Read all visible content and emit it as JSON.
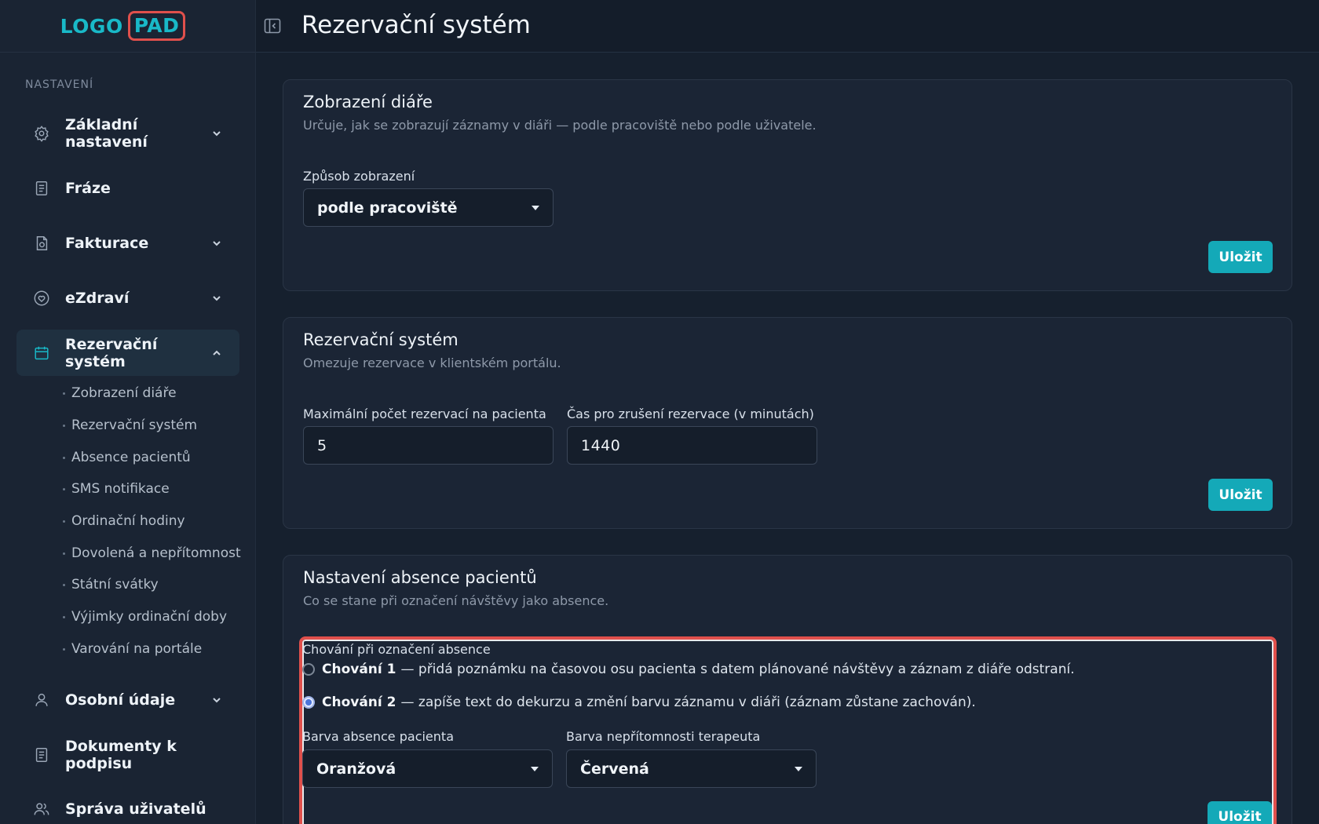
{
  "logo": {
    "part1": "LOGO",
    "part2": "PAD"
  },
  "sidebar": {
    "section": "NASTAVENÍ",
    "items": [
      {
        "label": "Základní nastavení",
        "icon": "gear-icon"
      },
      {
        "label": "Fráze",
        "icon": "document-icon"
      },
      {
        "label": "Fakturace",
        "icon": "invoice-icon"
      },
      {
        "label": "eZdraví",
        "icon": "heart-icon"
      },
      {
        "label": "Rezervační systém",
        "icon": "calendar-icon"
      },
      {
        "label": "Osobní údaje",
        "icon": "user-icon"
      },
      {
        "label": "Dokumenty k podpisu",
        "icon": "document-icon"
      },
      {
        "label": "Správa uživatelů",
        "icon": "users-icon"
      }
    ],
    "subitems": [
      "Zobrazení diáře",
      "Rezervační systém",
      "Absence pacientů",
      "SMS notifikace",
      "Ordinační hodiny",
      "Dovolená a nepřítomnost",
      "Státní svátky",
      "Výjimky ordinační doby",
      "Varování na portále"
    ]
  },
  "header": {
    "title": "Rezervační systém"
  },
  "cards": {
    "diary": {
      "title": "Zobrazení diáře",
      "desc": "Určuje, jak se zobrazují záznamy v diáři — podle pracoviště nebo podle uživatele.",
      "field_label": "Způsob zobrazení",
      "value": "podle pracoviště",
      "save": "Uložit"
    },
    "reservation": {
      "title": "Rezervační systém",
      "desc": "Omezuje rezervace v klientském portálu.",
      "max_label": "Maximální počet rezervací na pacienta",
      "max_value": "5",
      "cancel_label": "Čas pro zrušení rezervace (v minutách)",
      "cancel_value": "1440",
      "save": "Uložit"
    },
    "absence": {
      "title": "Nastavení absence pacientů",
      "desc": "Co se stane při označení návštěvy jako absence.",
      "behavior_label": "Chování při označení absence",
      "opt1_bold": "Chování 1",
      "opt1_text": "— přidá poznámku na časovou osu pacienta s datem plánované návštěvy a záznam z diáře odstraní.",
      "opt2_bold": "Chování 2",
      "opt2_text": "— zapíše text do dekurzu a změní barvu záznamu v diáři (záznam zůstane zachován).",
      "patient_color_label": "Barva absence pacienta",
      "patient_color": "Oranžová",
      "therapist_color_label": "Barva nepřítomnosti terapeuta",
      "therapist_color": "Červená",
      "save": "Uložit"
    }
  },
  "colors": {
    "accent": "#14a9b8",
    "highlight": "#e0504c",
    "background": "#16202e"
  }
}
